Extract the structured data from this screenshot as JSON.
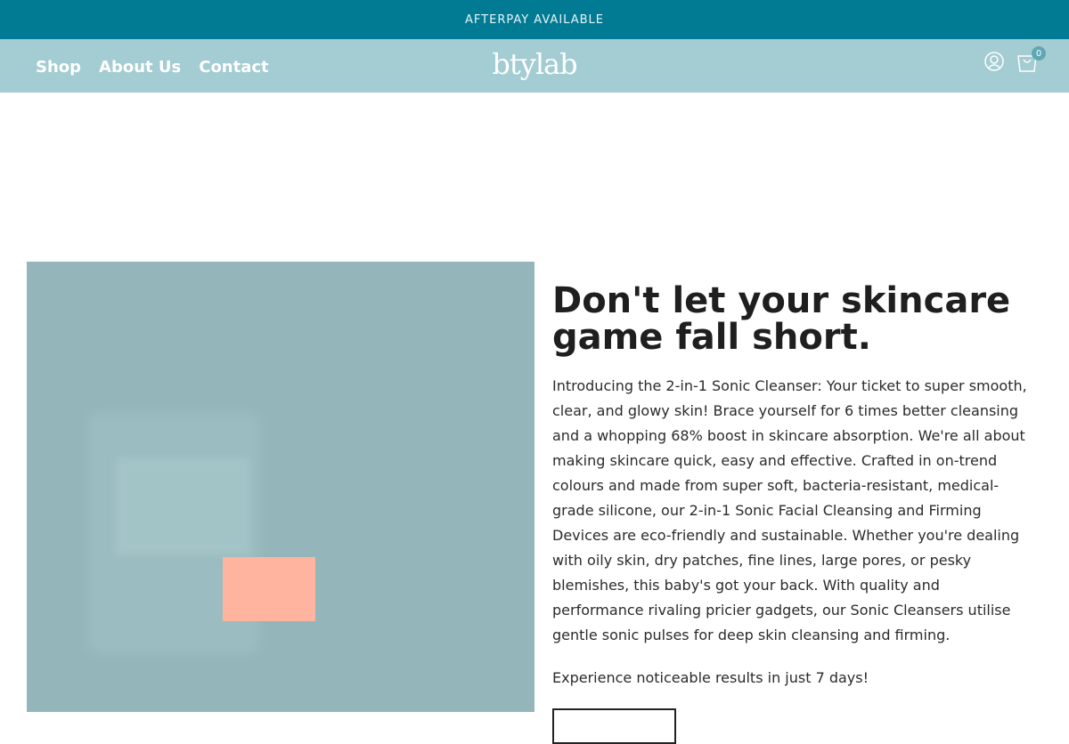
{
  "announcement": {
    "text": "AFTERPAY AVAILABLE"
  },
  "header": {
    "nav": [
      {
        "label": "Shop"
      },
      {
        "label": "About Us"
      },
      {
        "label": "Contact"
      }
    ],
    "logo_text": "btylab",
    "cart_count": "0",
    "icons": [
      "user-icon",
      "shopping-bag-icon"
    ]
  },
  "hero": {
    "headline": "Don't let your skincare game fall short.",
    "body": "Introducing the 2-in-1 Sonic Cleanser: Your ticket to super smooth, clear, and glowy skin! Brace yourself for 6 times better cleansing and a whopping 68% boost in skincare absorption. We're all about making skincare quick, easy and effective. Crafted in on-trend colours and made from super soft, bacteria-resistant, medical-grade silicone, our 2-in-1 Sonic Facial Cleansing and Firming Devices are eco-friendly and sustainable. Whether you're dealing with oily skin, dry patches, fine lines, large pores, or pesky blemishes, this baby's got your back. With quality and performance rivaling pricier gadgets, our Sonic Cleansers utilise gentle sonic pulses for deep skin cleansing and firming.",
    "tagline": "Experience noticeable results in just 7 days!"
  },
  "colors": {
    "announcement_bg": "#017b94",
    "header_bg": "#a3ccd3",
    "image_bg": "#94b6ba",
    "product_accent": "#ffb4a0"
  }
}
